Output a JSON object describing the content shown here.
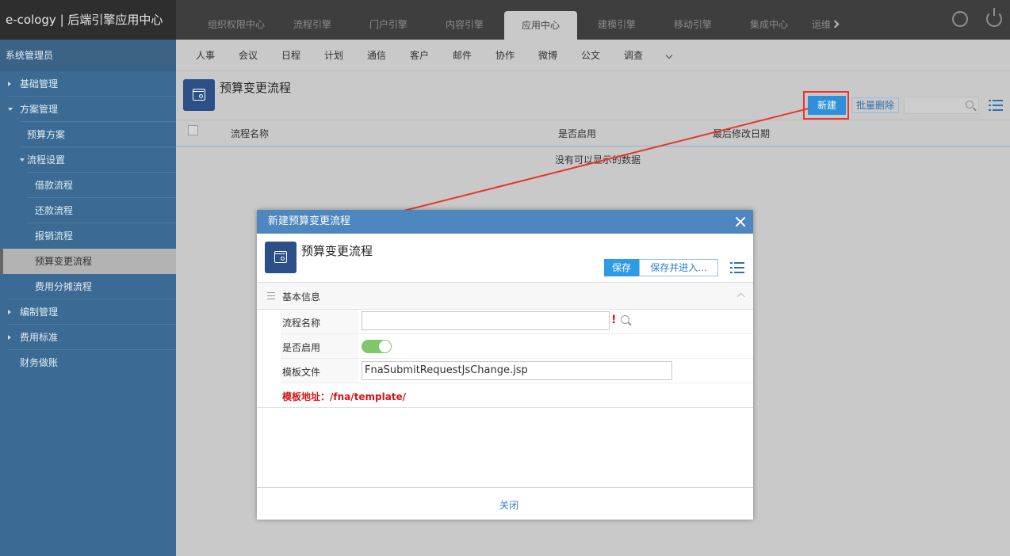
{
  "app": {
    "brand": "e-cology | 后端引擎应用中心"
  },
  "top_tabs": [
    {
      "label": "组织权限中心"
    },
    {
      "label": "流程引擎"
    },
    {
      "label": "门户引擎"
    },
    {
      "label": "内容引擎"
    },
    {
      "label": "应用中心"
    },
    {
      "label": "建模引擎"
    },
    {
      "label": "移动引擎"
    },
    {
      "label": "集成中心"
    },
    {
      "label": "运维"
    }
  ],
  "top_icons": [
    "more-dots-icon",
    "power-icon"
  ],
  "sidebar": {
    "header": "系统管理员",
    "items": [
      {
        "label": "基础管理"
      },
      {
        "label": "方案管理"
      },
      {
        "label": "预算方案"
      },
      {
        "label": "流程设置"
      },
      {
        "label": "借款流程"
      },
      {
        "label": "还款流程"
      },
      {
        "label": "报销流程"
      },
      {
        "label": "预算变更流程"
      },
      {
        "label": "费用分摊流程"
      },
      {
        "label": "编制管理"
      },
      {
        "label": "费用标准"
      },
      {
        "label": "财务做账"
      }
    ]
  },
  "subnav": [
    {
      "label": "人事"
    },
    {
      "label": "会议"
    },
    {
      "label": "日程"
    },
    {
      "label": "计划"
    },
    {
      "label": "通信"
    },
    {
      "label": "客户"
    },
    {
      "label": "邮件"
    },
    {
      "label": "协作"
    },
    {
      "label": "微博"
    },
    {
      "label": "公文"
    },
    {
      "label": "调查"
    }
  ],
  "page": {
    "title": "预算变更流程",
    "new_label": "新建",
    "batch_delete_label": "批量删除",
    "columns": [
      "流程名称",
      "是否启用",
      "最后修改日期"
    ],
    "empty_message": "没有可以显示的数据"
  },
  "dialog": {
    "titlebar": "新建预算变更流程",
    "title": "预算变更流程",
    "save_label": "保存",
    "save_enter_label": "保存并进入...",
    "section": "基本信息",
    "fields": {
      "name_label": "流程名称",
      "name_value": "",
      "enabled_label": "是否启用",
      "enabled": true,
      "template_label": "模板文件",
      "template_value": "FnaSubmitRequestJsChange.jsp"
    },
    "template_note": "模板地址：/fna/template/",
    "close_label": "关闭"
  },
  "colors": {
    "accent": "#2f8fd8",
    "sidebar": "#3b6b94",
    "dialog_header": "#4e86c0",
    "highlight": "#e8352f",
    "toggle_on": "#7ec86a"
  }
}
